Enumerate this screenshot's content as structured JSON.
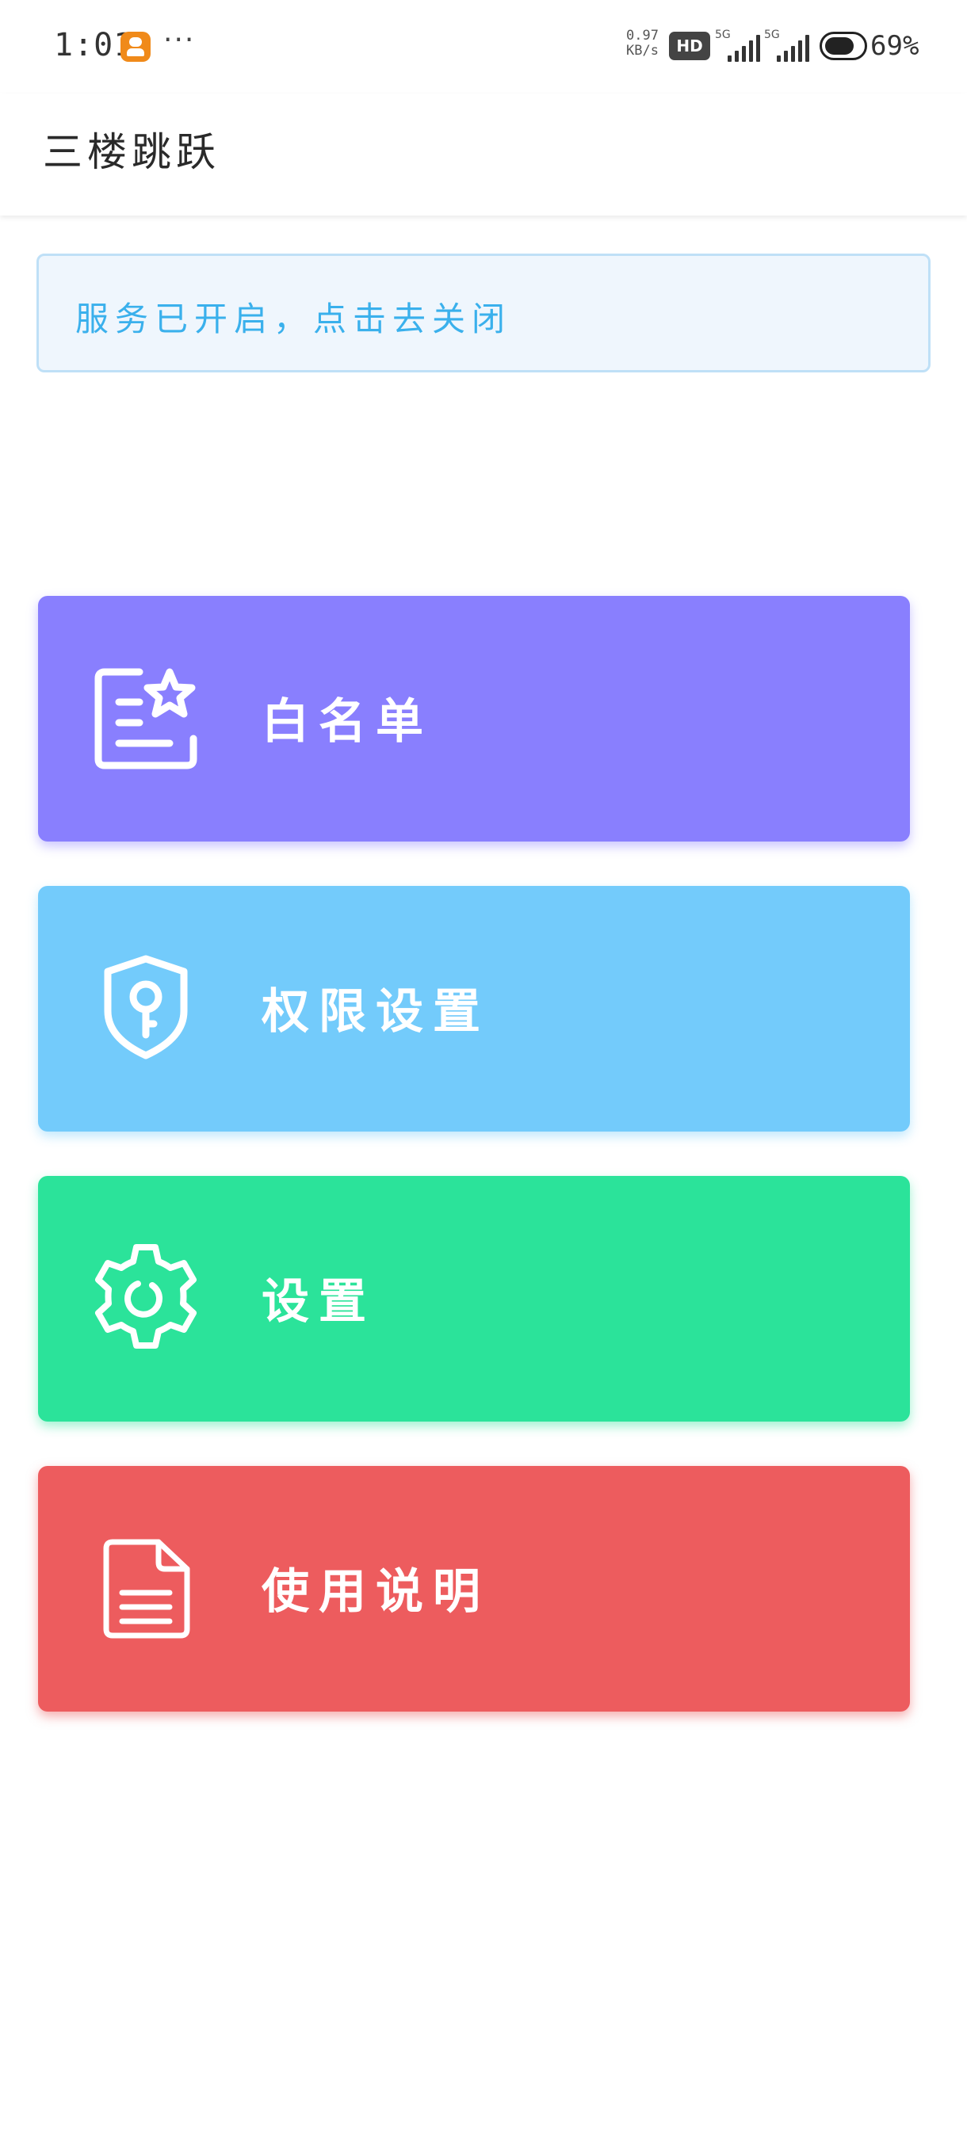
{
  "status_bar": {
    "time": "1:01",
    "more": "···",
    "net_speed_value": "0.97",
    "net_speed_unit": "KB/s",
    "hd_label": "HD",
    "sim1_label": "5G",
    "sim2_label": "5G",
    "battery_level": "69%"
  },
  "app_bar": {
    "title": "三楼跳跃"
  },
  "service_banner": {
    "text": "服务已开启，点击去关闭"
  },
  "menu": {
    "items": [
      {
        "label": "白名单",
        "icon": "list-star-icon",
        "color": "#897ffe"
      },
      {
        "label": "权限设置",
        "icon": "shield-key-icon",
        "color": "#73cbfb"
      },
      {
        "label": "设置",
        "icon": "gear-icon",
        "color": "#2be39a"
      },
      {
        "label": "使用说明",
        "icon": "document-icon",
        "color": "#ed5c5e"
      }
    ]
  }
}
